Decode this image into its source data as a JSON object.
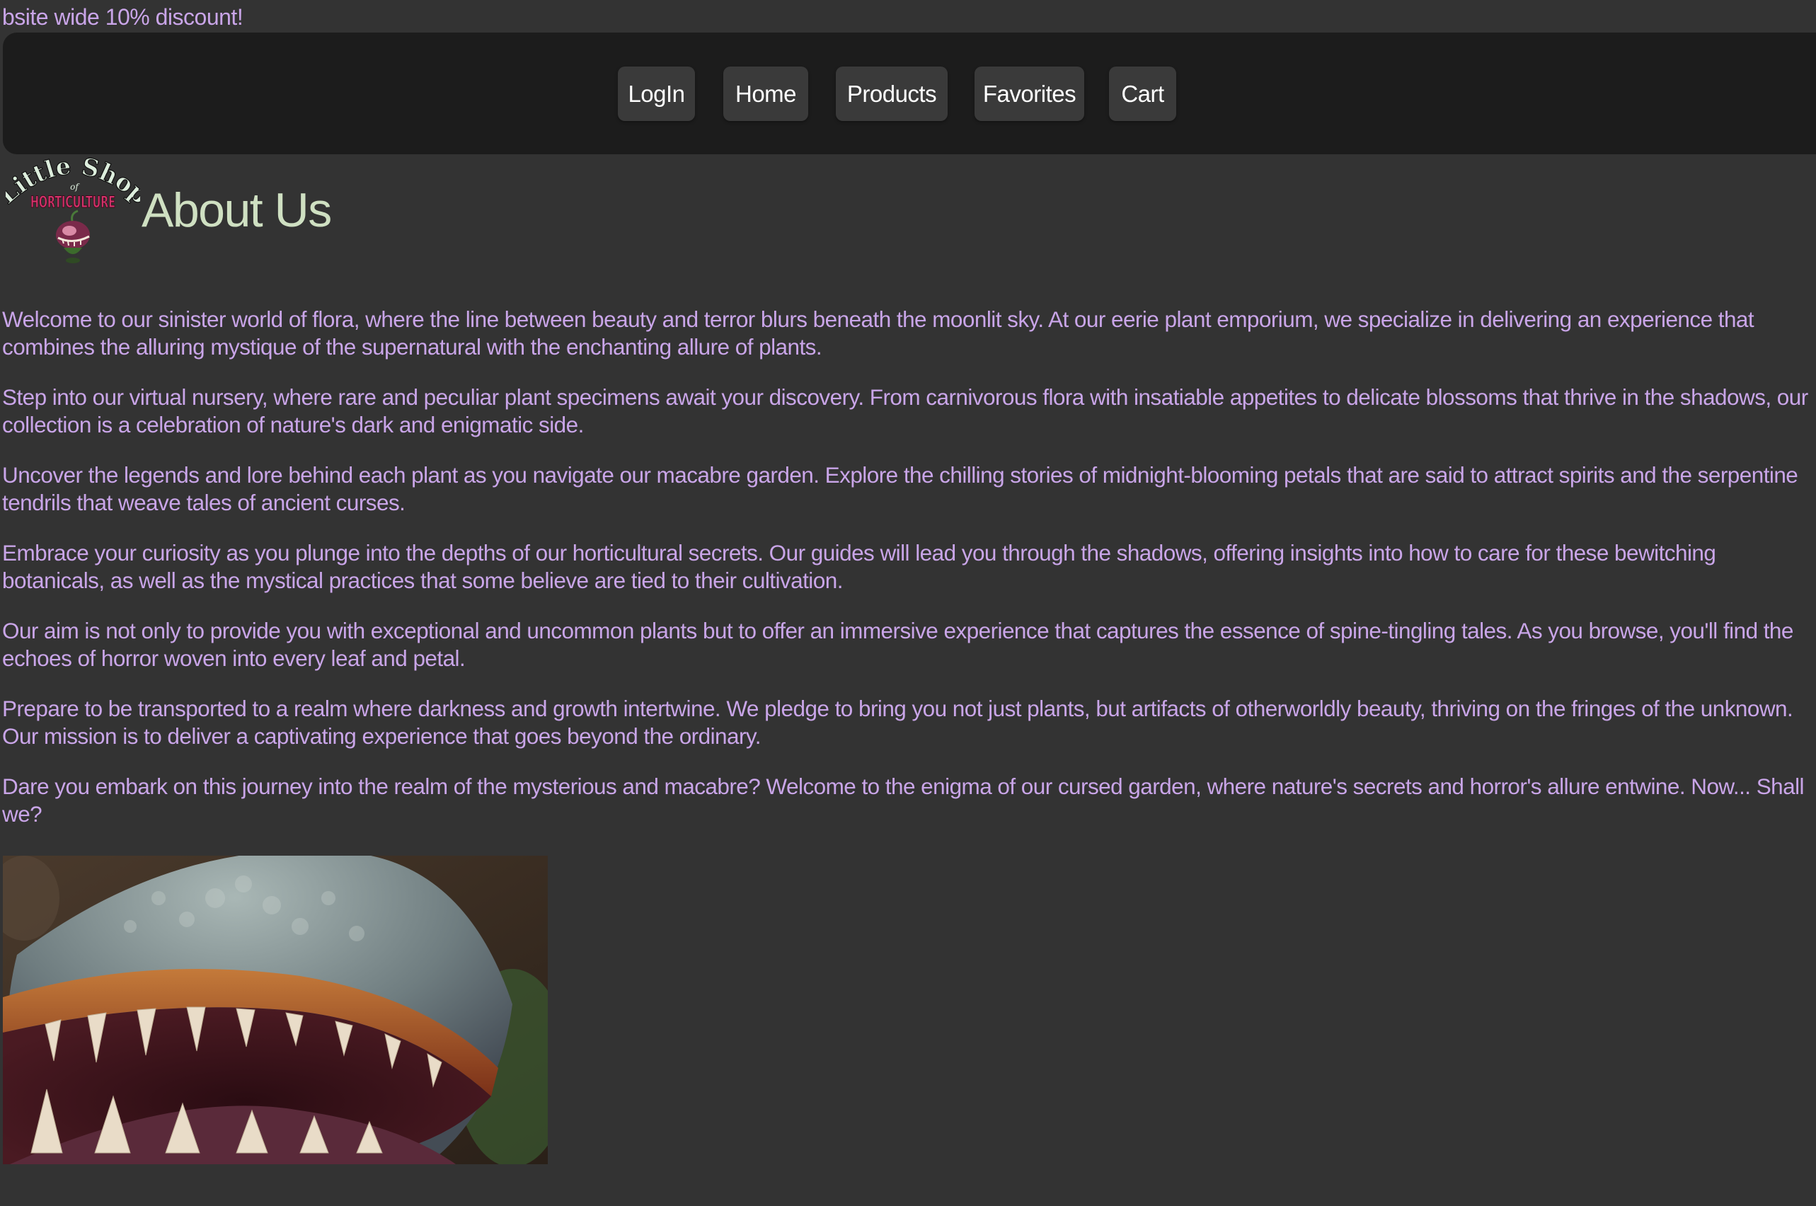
{
  "banner": {
    "text": "bsite wide 10% discount!"
  },
  "nav": {
    "items": [
      {
        "label": "LogIn"
      },
      {
        "label": "Home"
      },
      {
        "label": "Products"
      },
      {
        "label": "Favorites"
      },
      {
        "label": "Cart"
      }
    ]
  },
  "header": {
    "logo_icon": "little-shop-of-horticulture-logo",
    "logo_text_top": "Little Shop",
    "logo_text_of": "of",
    "logo_text_bottom": "HORTICULTURE",
    "title": "About Us"
  },
  "about": {
    "paragraphs": [
      "Welcome to our sinister world of flora, where the line between beauty and terror blurs beneath the moonlit sky. At our eerie plant emporium, we specialize in delivering an experience that combines the alluring mystique of the supernatural with the enchanting allure of plants.",
      "Step into our virtual nursery, where rare and peculiar plant specimens await your discovery. From carnivorous flora with insatiable appetites to delicate blossoms that thrive in the shadows, our collection is a celebration of nature's dark and enigmatic side.",
      "Uncover the legends and lore behind each plant as you navigate our macabre garden. Explore the chilling stories of midnight-blooming petals that are said to attract spirits and the serpentine tendrils that weave tales of ancient curses.",
      "Embrace your curiosity as you plunge into the depths of our horticultural secrets. Our guides will lead you through the shadows, offering insights into how to care for these bewitching botanicals, as well as the mystical practices that some believe are tied to their cultivation.",
      "Our aim is not only to provide you with exceptional and uncommon plants but to offer an immersive experience that captures the essence of spine-tingling tales. As you browse, you'll find the echoes of horror woven into every leaf and petal.",
      "Prepare to be transported to a realm where darkness and growth intertwine. We pledge to bring you not just plants, but artifacts of otherworldly beauty, thriving on the fringes of the unknown. Our mission is to deliver a captivating experience that goes beyond the ordinary.",
      "Dare you embark on this journey into the realm of the mysterious and macabre? Welcome to the enigma of our cursed garden, where nature's secrets and horror's allure entwine. Now... Shall we?"
    ]
  },
  "image": {
    "icon": "carnivorous-plant-mouth-photo"
  },
  "colors": {
    "background": "#333333",
    "navbar": "#1c1c1c",
    "nav_button": "#3a3a3a",
    "text_purple": "#c9a5e8",
    "title_green": "#cfe0c2"
  }
}
